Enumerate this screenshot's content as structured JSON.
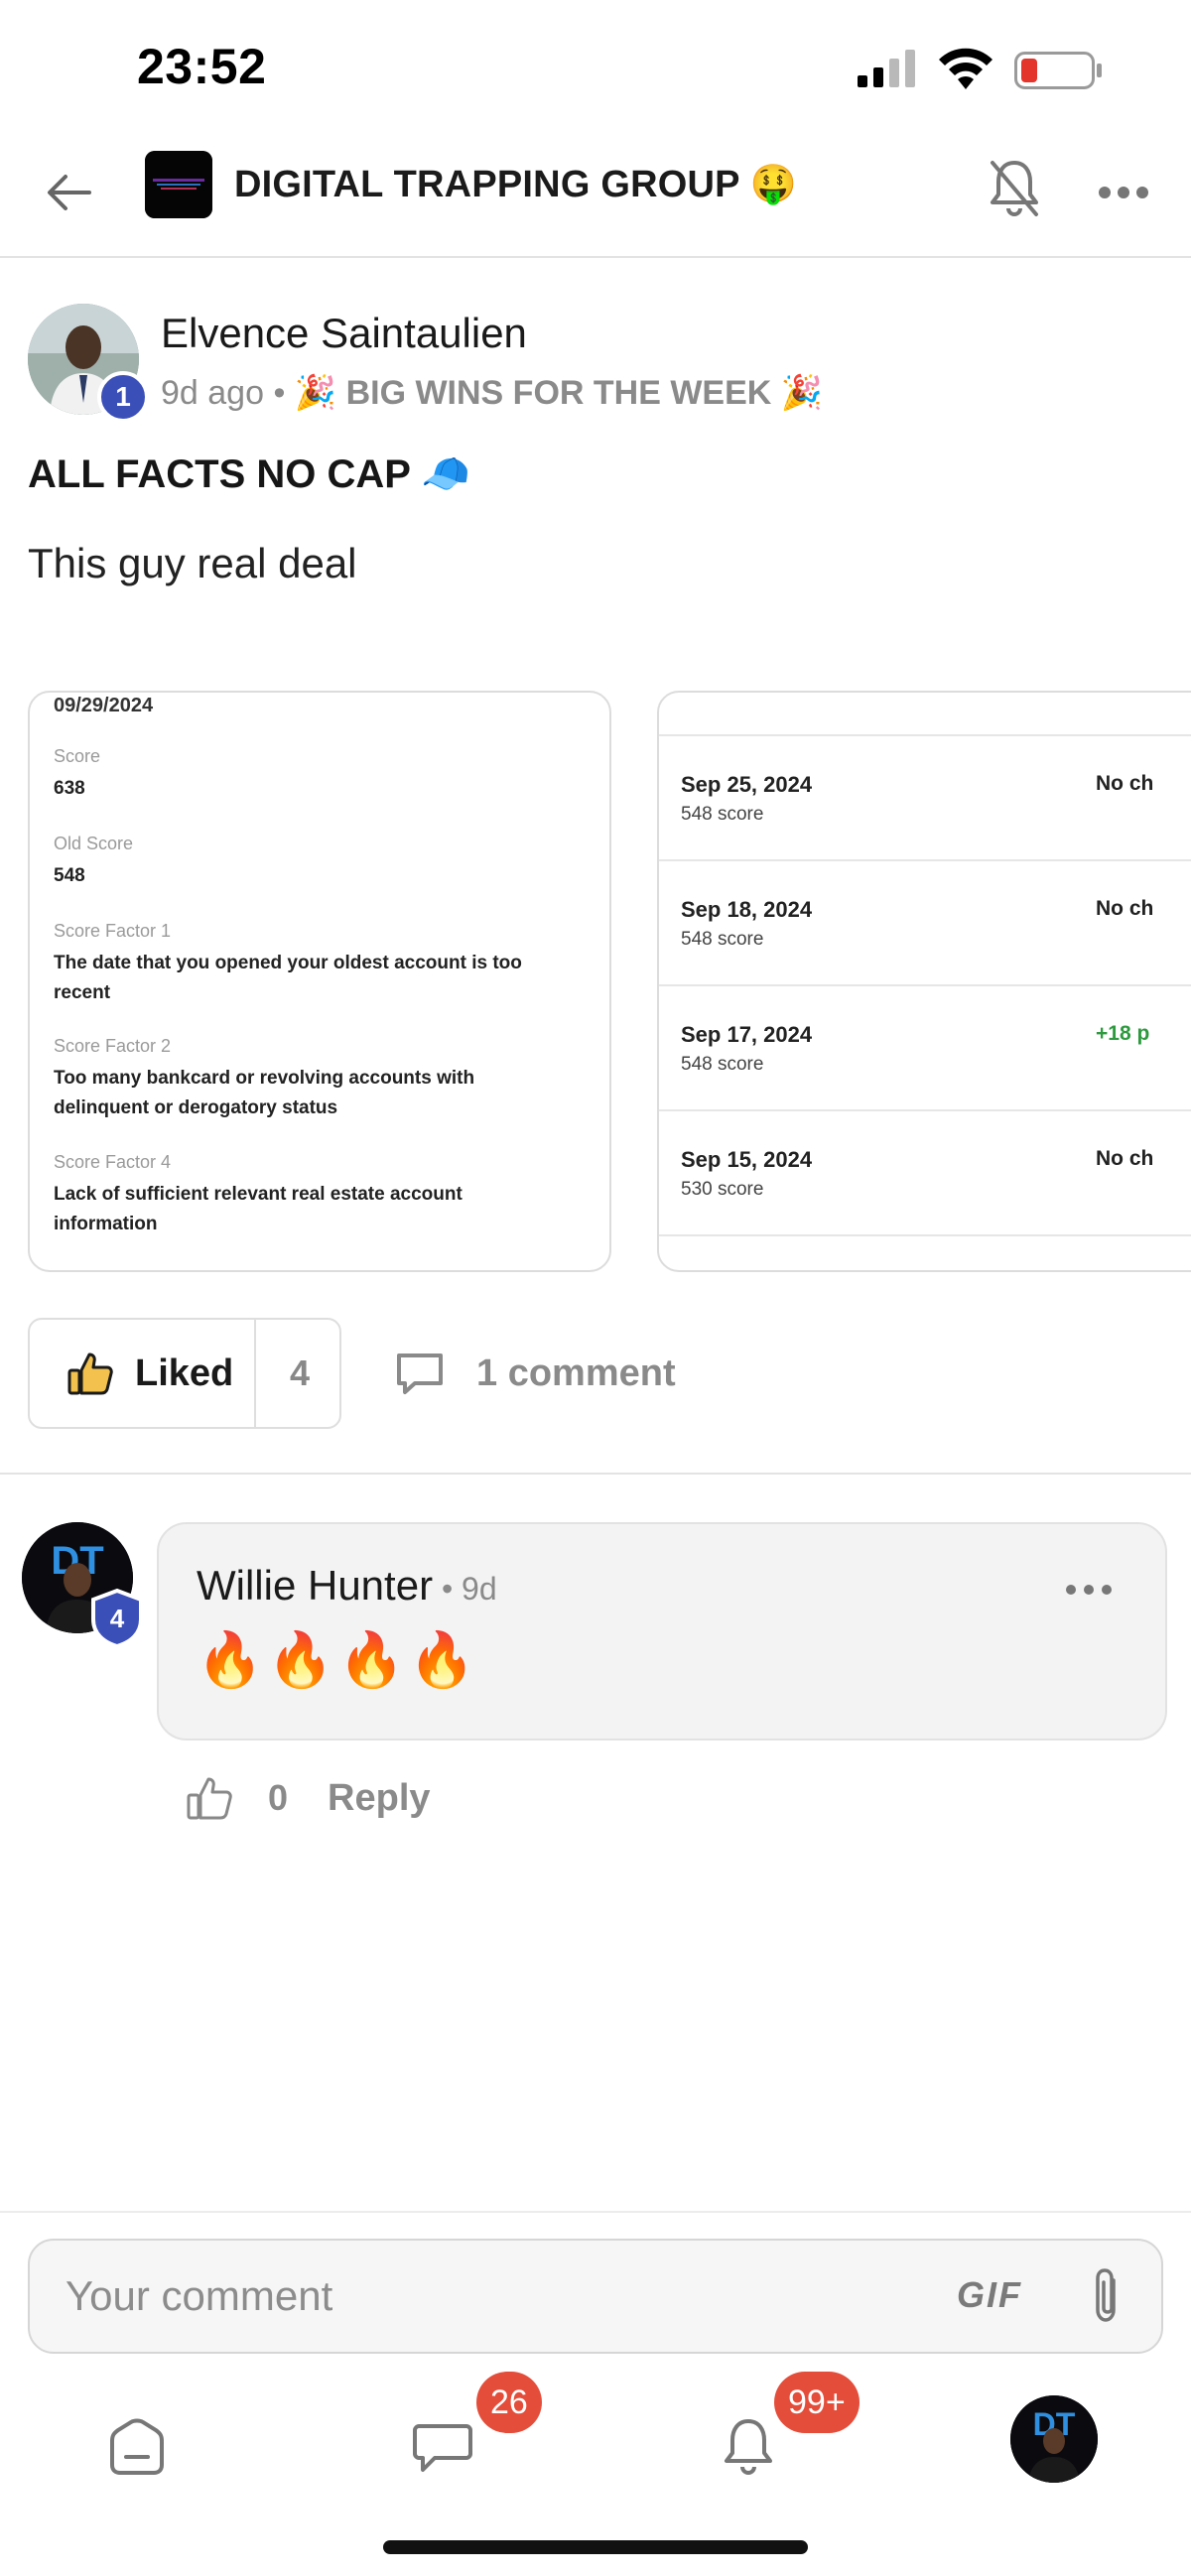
{
  "status_bar": {
    "time": "23:52"
  },
  "header": {
    "group_name": "DIGITAL TRAPPING GROUP 🤑"
  },
  "post": {
    "author": "Elvence Saintaulien",
    "level": "1",
    "time_ago": "9d ago",
    "separator": " • ",
    "category": "🎉 BIG WINS FOR THE WEEK 🎉",
    "title": "ALL FACTS NO CAP 🧢",
    "body": "This guy real deal",
    "image1": {
      "date": "09/29/2024",
      "fields": [
        {
          "label": "Score",
          "value": "638"
        },
        {
          "label": "Old Score",
          "value": "548"
        },
        {
          "label": "Score Factor 1",
          "value": "The date that you opened your oldest account is too recent"
        },
        {
          "label": "Score Factor 2",
          "value": "Too many bankcard or revolving accounts with delinquent or derogatory status"
        },
        {
          "label": "Score Factor 4",
          "value": "Lack of sufficient relevant real estate account information"
        }
      ]
    },
    "image2": {
      "rows": [
        {
          "date": "Sep 25, 2024",
          "score": "548 score",
          "change": "No ch"
        },
        {
          "date": "Sep 18, 2024",
          "score": "548 score",
          "change": "No ch"
        },
        {
          "date": "Sep 17, 2024",
          "score": "548 score",
          "change": "+18 p"
        },
        {
          "date": "Sep 15, 2024",
          "score": "530 score",
          "change": "No ch"
        }
      ]
    },
    "like_label": "Liked",
    "like_count": "4",
    "comment_count_label": "1 comment"
  },
  "comment": {
    "author": "Willie Hunter",
    "time": " • 9d",
    "level": "4",
    "text": "🔥🔥🔥🔥",
    "like_count": "0",
    "reply_label": "Reply"
  },
  "composer": {
    "placeholder": "Your comment",
    "gif_label": "GIF"
  },
  "bottom_nav": {
    "chat_badge": "26",
    "notifications_badge": "99+"
  },
  "colors": {
    "accent": "#3b4fb8",
    "badge_red": "#e44d3a",
    "positive": "#2e9a3f"
  }
}
